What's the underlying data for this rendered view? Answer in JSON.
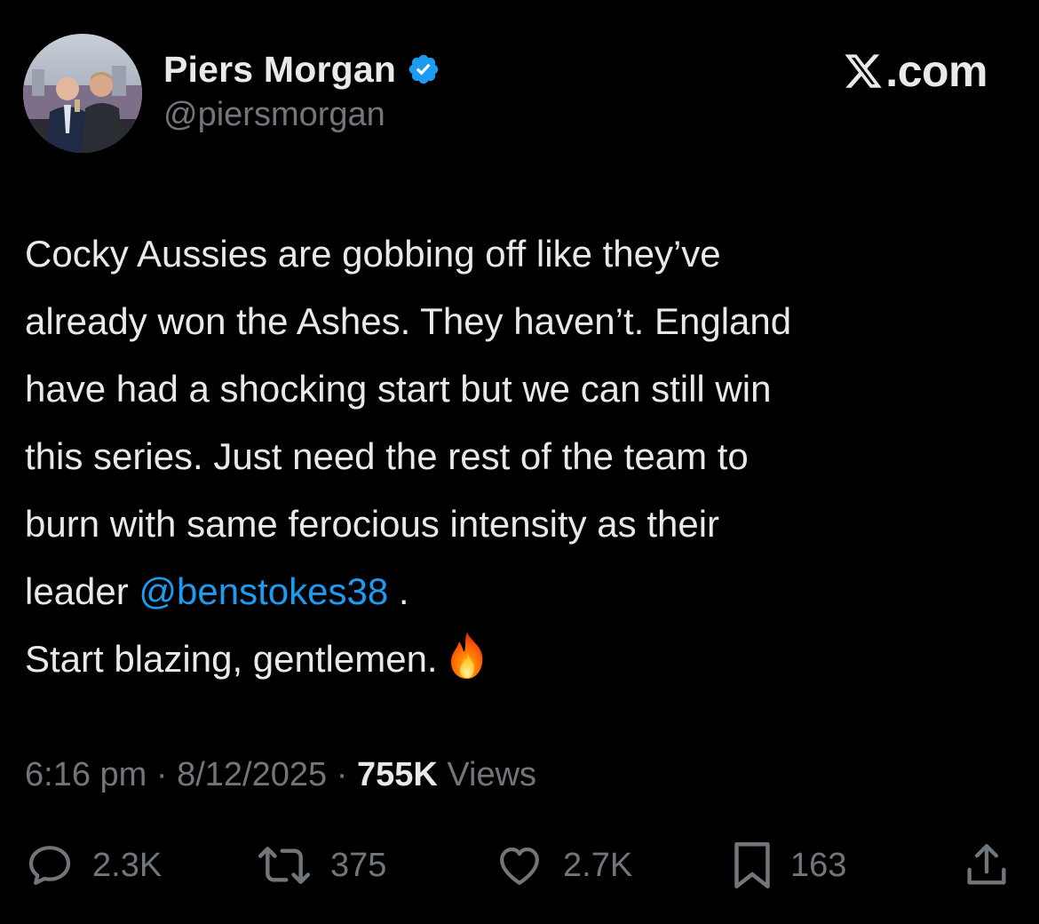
{
  "author": {
    "display_name": "Piers Morgan",
    "handle": "@piersmorgan",
    "verified": true
  },
  "brand": {
    "suffix": ".com"
  },
  "tweet": {
    "lines": {
      "l1": "Cocky Aussies are gobbing off like they’ve",
      "l2": "already won the Ashes. They haven’t. England",
      "l3": "have had a shocking start but we can still win",
      "l4": "this series. Just need the rest of the team to",
      "l5": "burn with same ferocious intensity as their",
      "l6_prefix": "leader ",
      "l6_mention": "@benstokes38",
      "l6_suffix": " .",
      "l7": "Start blazing, gentlemen."
    },
    "emoji": "fire-icon"
  },
  "meta": {
    "time": "6:16 pm",
    "sep1": " · ",
    "date": "8/12/2025",
    "sep2": " · ",
    "views_count": "755K",
    "views_label": " Views"
  },
  "actions": {
    "replies": "2.3K",
    "reposts": "375",
    "likes": "2.7K",
    "bookmarks": "163"
  },
  "colors": {
    "background": "#000000",
    "text": "#e7e9ea",
    "secondary": "#71767b",
    "link": "#1d9bf0",
    "verified": "#1d9bf0"
  }
}
